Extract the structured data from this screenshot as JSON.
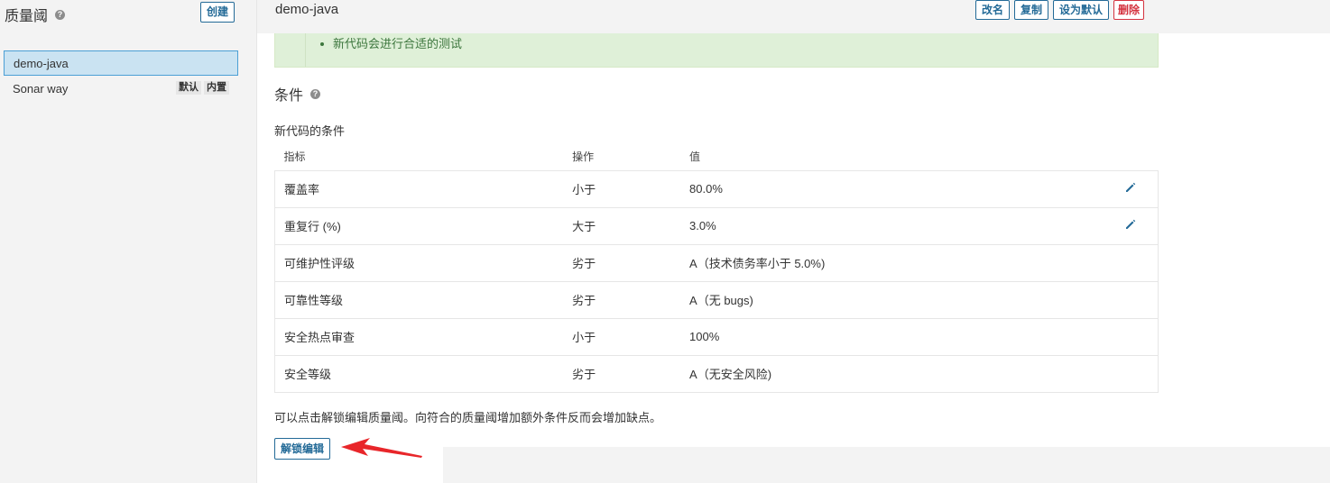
{
  "sidebar": {
    "title": "质量阈",
    "create_label": "创建",
    "gates": [
      {
        "name": "demo-java",
        "badges": []
      },
      {
        "name": "Sonar way",
        "badges": [
          "默认",
          "内置"
        ]
      }
    ]
  },
  "header": {
    "gate_name": "demo-java",
    "actions": {
      "rename": "改名",
      "copy": "复制",
      "set_default": "设为默认",
      "delete": "删除"
    }
  },
  "alert": {
    "items": [
      "新代码会进行合适的测试"
    ]
  },
  "conditions": {
    "title": "条件",
    "subtitle": "新代码的条件",
    "columns": {
      "metric": "指标",
      "operator": "操作",
      "value": "值"
    },
    "rows": [
      {
        "metric": "覆盖率",
        "operator": "小于",
        "value": "80.0%",
        "editable": true
      },
      {
        "metric": "重复行 (%)",
        "operator": "大于",
        "value": "3.0%",
        "editable": true
      },
      {
        "metric": "可维护性评级",
        "operator": "劣于",
        "value": "A（技术债务率小于 5.0%)",
        "editable": false
      },
      {
        "metric": "可靠性等级",
        "operator": "劣于",
        "value": "A（无 bugs)",
        "editable": false
      },
      {
        "metric": "安全热点审查",
        "operator": "小于",
        "value": "100%",
        "editable": false
      },
      {
        "metric": "安全等级",
        "operator": "劣于",
        "value": "A（无安全风险)",
        "editable": false
      }
    ]
  },
  "footer": {
    "hint": "可以点击解锁编辑质量阈。向符合的质量阈增加额外条件反而会增加缺点。",
    "unlock_label": "解锁编辑"
  },
  "colors": {
    "primary": "#236a97",
    "danger": "#d4333f",
    "success_bg": "#dff0d8",
    "success_text": "#3c763d",
    "selected_bg": "#cae3f2",
    "annotation_arrow": "#e8262a"
  }
}
